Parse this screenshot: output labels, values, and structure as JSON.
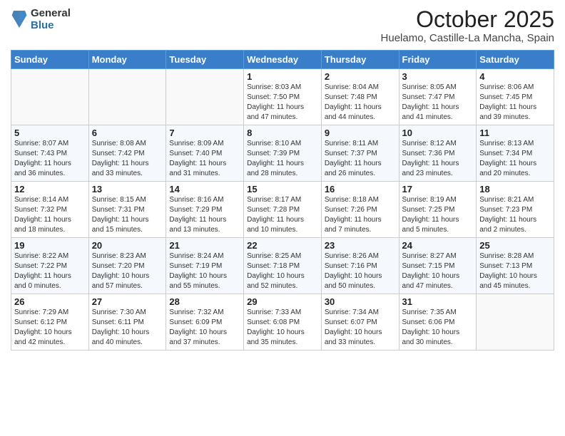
{
  "header": {
    "logo_general": "General",
    "logo_blue": "Blue",
    "month": "October 2025",
    "location": "Huelamo, Castille-La Mancha, Spain"
  },
  "weekdays": [
    "Sunday",
    "Monday",
    "Tuesday",
    "Wednesday",
    "Thursday",
    "Friday",
    "Saturday"
  ],
  "weeks": [
    [
      {
        "day": "",
        "info": ""
      },
      {
        "day": "",
        "info": ""
      },
      {
        "day": "",
        "info": ""
      },
      {
        "day": "1",
        "info": "Sunrise: 8:03 AM\nSunset: 7:50 PM\nDaylight: 11 hours\nand 47 minutes."
      },
      {
        "day": "2",
        "info": "Sunrise: 8:04 AM\nSunset: 7:48 PM\nDaylight: 11 hours\nand 44 minutes."
      },
      {
        "day": "3",
        "info": "Sunrise: 8:05 AM\nSunset: 7:47 PM\nDaylight: 11 hours\nand 41 minutes."
      },
      {
        "day": "4",
        "info": "Sunrise: 8:06 AM\nSunset: 7:45 PM\nDaylight: 11 hours\nand 39 minutes."
      }
    ],
    [
      {
        "day": "5",
        "info": "Sunrise: 8:07 AM\nSunset: 7:43 PM\nDaylight: 11 hours\nand 36 minutes."
      },
      {
        "day": "6",
        "info": "Sunrise: 8:08 AM\nSunset: 7:42 PM\nDaylight: 11 hours\nand 33 minutes."
      },
      {
        "day": "7",
        "info": "Sunrise: 8:09 AM\nSunset: 7:40 PM\nDaylight: 11 hours\nand 31 minutes."
      },
      {
        "day": "8",
        "info": "Sunrise: 8:10 AM\nSunset: 7:39 PM\nDaylight: 11 hours\nand 28 minutes."
      },
      {
        "day": "9",
        "info": "Sunrise: 8:11 AM\nSunset: 7:37 PM\nDaylight: 11 hours\nand 26 minutes."
      },
      {
        "day": "10",
        "info": "Sunrise: 8:12 AM\nSunset: 7:36 PM\nDaylight: 11 hours\nand 23 minutes."
      },
      {
        "day": "11",
        "info": "Sunrise: 8:13 AM\nSunset: 7:34 PM\nDaylight: 11 hours\nand 20 minutes."
      }
    ],
    [
      {
        "day": "12",
        "info": "Sunrise: 8:14 AM\nSunset: 7:32 PM\nDaylight: 11 hours\nand 18 minutes."
      },
      {
        "day": "13",
        "info": "Sunrise: 8:15 AM\nSunset: 7:31 PM\nDaylight: 11 hours\nand 15 minutes."
      },
      {
        "day": "14",
        "info": "Sunrise: 8:16 AM\nSunset: 7:29 PM\nDaylight: 11 hours\nand 13 minutes."
      },
      {
        "day": "15",
        "info": "Sunrise: 8:17 AM\nSunset: 7:28 PM\nDaylight: 11 hours\nand 10 minutes."
      },
      {
        "day": "16",
        "info": "Sunrise: 8:18 AM\nSunset: 7:26 PM\nDaylight: 11 hours\nand 7 minutes."
      },
      {
        "day": "17",
        "info": "Sunrise: 8:19 AM\nSunset: 7:25 PM\nDaylight: 11 hours\nand 5 minutes."
      },
      {
        "day": "18",
        "info": "Sunrise: 8:21 AM\nSunset: 7:23 PM\nDaylight: 11 hours\nand 2 minutes."
      }
    ],
    [
      {
        "day": "19",
        "info": "Sunrise: 8:22 AM\nSunset: 7:22 PM\nDaylight: 11 hours\nand 0 minutes."
      },
      {
        "day": "20",
        "info": "Sunrise: 8:23 AM\nSunset: 7:20 PM\nDaylight: 10 hours\nand 57 minutes."
      },
      {
        "day": "21",
        "info": "Sunrise: 8:24 AM\nSunset: 7:19 PM\nDaylight: 10 hours\nand 55 minutes."
      },
      {
        "day": "22",
        "info": "Sunrise: 8:25 AM\nSunset: 7:18 PM\nDaylight: 10 hours\nand 52 minutes."
      },
      {
        "day": "23",
        "info": "Sunrise: 8:26 AM\nSunset: 7:16 PM\nDaylight: 10 hours\nand 50 minutes."
      },
      {
        "day": "24",
        "info": "Sunrise: 8:27 AM\nSunset: 7:15 PM\nDaylight: 10 hours\nand 47 minutes."
      },
      {
        "day": "25",
        "info": "Sunrise: 8:28 AM\nSunset: 7:13 PM\nDaylight: 10 hours\nand 45 minutes."
      }
    ],
    [
      {
        "day": "26",
        "info": "Sunrise: 7:29 AM\nSunset: 6:12 PM\nDaylight: 10 hours\nand 42 minutes."
      },
      {
        "day": "27",
        "info": "Sunrise: 7:30 AM\nSunset: 6:11 PM\nDaylight: 10 hours\nand 40 minutes."
      },
      {
        "day": "28",
        "info": "Sunrise: 7:32 AM\nSunset: 6:09 PM\nDaylight: 10 hours\nand 37 minutes."
      },
      {
        "day": "29",
        "info": "Sunrise: 7:33 AM\nSunset: 6:08 PM\nDaylight: 10 hours\nand 35 minutes."
      },
      {
        "day": "30",
        "info": "Sunrise: 7:34 AM\nSunset: 6:07 PM\nDaylight: 10 hours\nand 33 minutes."
      },
      {
        "day": "31",
        "info": "Sunrise: 7:35 AM\nSunset: 6:06 PM\nDaylight: 10 hours\nand 30 minutes."
      },
      {
        "day": "",
        "info": ""
      }
    ]
  ]
}
